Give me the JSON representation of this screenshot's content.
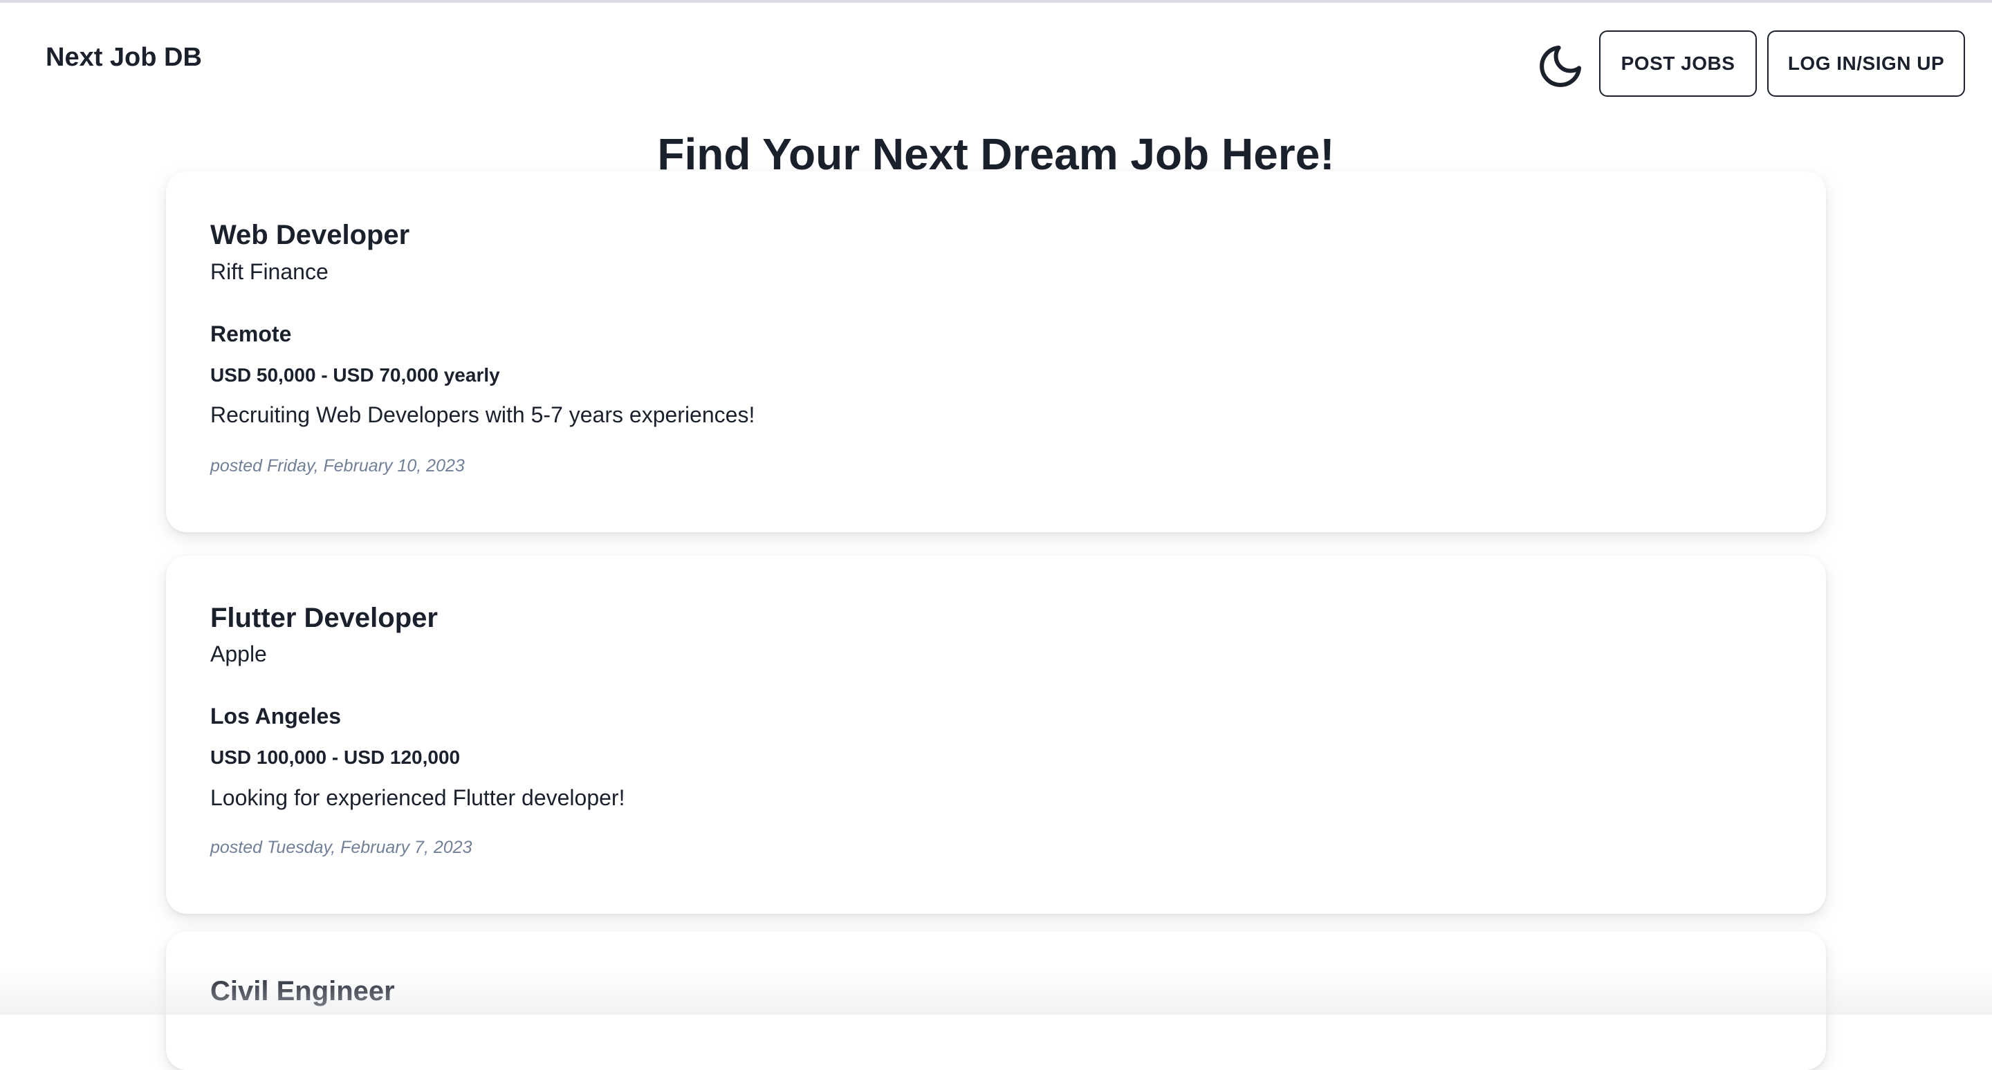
{
  "app": {
    "brand": "Next Job DB"
  },
  "nav": {
    "theme_toggle_icon": "moon-icon",
    "post_jobs_label": "POST JOBS",
    "login_label": "LOG IN/SIGN UP"
  },
  "main": {
    "heading": "Find Your Next Dream Job Here!"
  },
  "jobs": [
    {
      "title": "Web Developer",
      "company": "Rift Finance",
      "location": "Remote",
      "salary": "USD 50,000 - USD 70,000 yearly",
      "description": "Recruiting Web Developers with 5-7 years experiences!",
      "posted": "posted Friday, February 10, 2023"
    },
    {
      "title": "Flutter Developer",
      "company": "Apple",
      "location": "Los Angeles",
      "salary": "USD 100,000 - USD 120,000",
      "description": "Looking for experienced Flutter developer!",
      "posted": "posted Tuesday, February 7, 2023"
    },
    {
      "title": "Civil Engineer"
    }
  ],
  "colors": {
    "text": "#1a202c",
    "muted": "#718096",
    "background": "#ffffff"
  }
}
